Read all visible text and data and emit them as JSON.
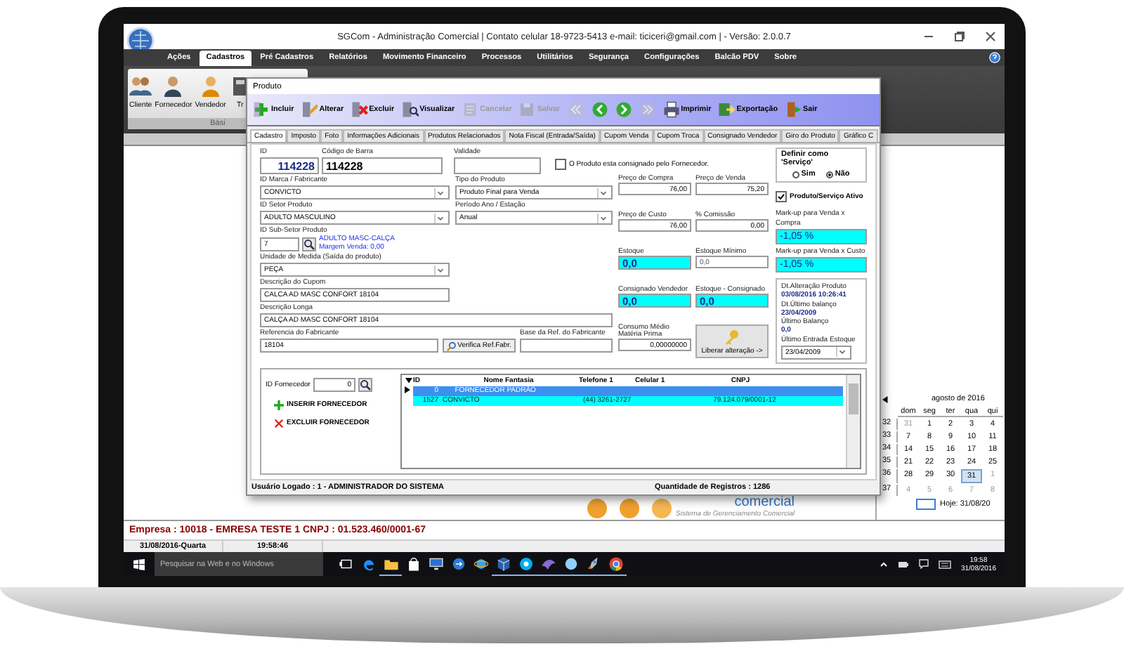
{
  "window": {
    "title": "SGCom - Administração Comercial | Contato celular 18-9723-5413 e-mail: ticiceri@gmail.com | - Versão: 2.0.0.7"
  },
  "menu": [
    {
      "label": "Ações",
      "selected": false
    },
    {
      "label": "Cadastros",
      "selected": true
    },
    {
      "label": "Pré Cadastros",
      "selected": false
    },
    {
      "label": "Relatórios",
      "selected": false
    },
    {
      "label": "Movimento Financeiro",
      "selected": false
    },
    {
      "label": "Processos",
      "selected": false
    },
    {
      "label": "Utilitários",
      "selected": false
    },
    {
      "label": "Segurança",
      "selected": false
    },
    {
      "label": "Configurações",
      "selected": false
    },
    {
      "label": "Balcão PDV",
      "selected": false
    },
    {
      "label": "Sobre",
      "selected": false
    }
  ],
  "ribbon": {
    "items": [
      {
        "label": "Cliente",
        "kind": "people"
      },
      {
        "label": "Fornecedor",
        "kind": "person"
      },
      {
        "label": "Vendedor",
        "kind": "seller"
      },
      {
        "label": "Tr",
        "kind": "box"
      }
    ],
    "group": "Bási"
  },
  "dialog": {
    "title": "Produto",
    "toolbar": [
      {
        "kind": "add",
        "label": "Incluir",
        "disabled": false
      },
      {
        "kind": "edit",
        "label": "Alterar",
        "disabled": false
      },
      {
        "kind": "delete",
        "label": "Excluir",
        "disabled": false
      },
      {
        "kind": "view",
        "label": "Visualizar",
        "disabled": false
      },
      {
        "kind": "cancel",
        "label": "Cancelar",
        "disabled": true
      },
      {
        "kind": "save",
        "label": "Salvar",
        "disabled": true
      },
      {
        "kind": "first",
        "disabled": true
      },
      {
        "kind": "prev",
        "disabled": false
      },
      {
        "kind": "next",
        "disabled": false
      },
      {
        "kind": "last",
        "disabled": true
      },
      {
        "kind": "print",
        "label": "Imprimir",
        "disabled": false
      },
      {
        "kind": "export",
        "label": "Exportação",
        "disabled": false
      },
      {
        "kind": "exit",
        "label": "Sair",
        "disabled": false
      }
    ],
    "tabs": [
      {
        "label": "Cadastro",
        "selected": true
      },
      {
        "label": "Imposto",
        "selected": false
      },
      {
        "label": "Foto",
        "selected": false
      },
      {
        "label": "Informações Adicionais",
        "selected": false
      },
      {
        "label": "Produtos Relacionados",
        "selected": false
      },
      {
        "label": "Nota Fiscal (Entrada/Saída)",
        "selected": false
      },
      {
        "label": "Cupom Venda",
        "selected": false
      },
      {
        "label": "Cupom Troca",
        "selected": false
      },
      {
        "label": "Consignado Vendedor",
        "selected": false
      },
      {
        "label": "Giro do Produto",
        "selected": false
      },
      {
        "label": "Gráfico C",
        "selected": false
      }
    ],
    "id": {
      "label": "ID",
      "value": "114228"
    },
    "barcode": {
      "label": "Código de Barra",
      "value": "114228"
    },
    "validity": {
      "label": "Validade"
    },
    "consigned": {
      "label": "O Produto esta consignado pelo Fornecedor.",
      "checked": false
    },
    "brand": {
      "label": "ID Marca / Fabricante",
      "value": "CONVICTO"
    },
    "product_type": {
      "label": "Tipo do Produto",
      "value": "Produto Final para Venda"
    },
    "sector": {
      "label": "ID Setor Produto",
      "value": "ADULTO MASCULINO"
    },
    "period": {
      "label": "Período Ano / Estação",
      "value": "Anual"
    },
    "subsector": {
      "label": "ID Sub-Setor Produto",
      "value": "7",
      "name": "ADULTO MASC-CALÇA",
      "margin": "Margem Venda: 0,00"
    },
    "unit": {
      "label": "Unidade de Medida (Saída do produto)",
      "value": "PEÇA"
    },
    "coupon_description": {
      "label": "Descrição do Cupom",
      "value": "CALCA AD MASC CONFORT 18104"
    },
    "long_description": {
      "label": "Descrição Longa",
      "value": "CALÇA AD MASC CONFORT 18104"
    },
    "manufacturer_ref": {
      "label": "Referencia do Fabricante",
      "value": "18104"
    },
    "verify_button": "Verifica Ref.Fabr.",
    "ref_base": {
      "label": "Base da Ref. do Fabricante"
    },
    "prices": [
      {
        "label": "Preço de Compra",
        "value": "76,00",
        "kind": "number",
        "highlighted": false
      },
      {
        "label": "Preço de Venda",
        "value": "75,20",
        "kind": "number",
        "highlighted": false
      },
      {
        "label": "Preço de Custo",
        "value": "76,00",
        "kind": "number",
        "highlighted": false
      },
      {
        "label": "% Comissão",
        "value": "0,00",
        "kind": "number",
        "highlighted": false
      },
      {
        "label": "Estoque",
        "value": "0,0",
        "kind": "big",
        "highlighted": true
      },
      {
        "label": "Estoque Mínimo",
        "value": "0,0",
        "kind": "muted",
        "highlighted": false
      },
      {
        "label": "Consignado Vendedor",
        "value": "0,0",
        "kind": "big",
        "highlighted": true
      },
      {
        "label": "Estoque - Consignado",
        "value": "0,0",
        "kind": "big",
        "highlighted": true
      },
      {
        "label": "Consumo Médio Matéria Prima",
        "value": "0,00000000",
        "kind": "number",
        "highlighted": false
      }
    ],
    "unlock_button": "Liberar alteração ->",
    "service": {
      "title": "Definir como 'Serviço'",
      "options": [
        {
          "label": "Sim",
          "selected": false
        },
        {
          "label": "Não",
          "selected": true
        }
      ]
    },
    "active": {
      "label": "Produto/Serviço Ativo",
      "checked": true
    },
    "markups": [
      {
        "label": "Mark-up para Venda x Compra",
        "value": "-1,05 %"
      },
      {
        "label": "Mark-up para Venda x Custo",
        "value": "-1,05 %"
      }
    ],
    "info": [
      {
        "label": "Dt.Alteração Produto",
        "value": "03/08/2016 10:26:41"
      },
      {
        "label": "Dt.Último balanço",
        "value": "23/04/2009"
      },
      {
        "label": "Último Balanço",
        "value": "0,0"
      }
    ],
    "last_entry": {
      "label": "Último Entrada Estoque",
      "value": "23/04/2009"
    },
    "supplier": {
      "label": "ID Fornecedor",
      "value": "0",
      "insert": "INSERIR FORNECEDOR",
      "delete": "EXCLUIR FORNECEDOR"
    },
    "table": {
      "columns": [
        "ID",
        "Nome Fantasia",
        "Telefone 1",
        "Celular 1",
        "CNPJ"
      ],
      "rows": [
        {
          "id": "0",
          "name": "FORNECEDOR PADRÃO",
          "selected": true
        },
        {
          "id": "1527",
          "name": "CONVICTO",
          "phone": "(44) 3261-2727",
          "cnpj": "79.124.079/0001-12",
          "selected": false
        }
      ]
    },
    "status": {
      "user": "Usuário Logado : 1 - ADMINISTRADOR DO SISTEMA",
      "records": "Quantidade de Registros : 1286"
    }
  },
  "logo": {
    "word": "comercial",
    "tagline": "Sistema de Gerenciamento Comercial"
  },
  "calendar": {
    "title": "agosto de 2016",
    "weekdays": [
      "dom",
      "seg",
      "ter",
      "qua",
      "qui"
    ],
    "weeks": [
      {
        "number": "32",
        "days": [
          {
            "label": "31",
            "muted": true,
            "selected": false
          },
          {
            "label": "1",
            "muted": false,
            "selected": false
          },
          {
            "label": "2",
            "muted": false,
            "selected": false
          },
          {
            "label": "3",
            "muted": false,
            "selected": false
          },
          {
            "label": "4",
            "muted": false,
            "selected": false
          }
        ]
      },
      {
        "number": "33",
        "days": [
          {
            "label": "7",
            "muted": false,
            "selected": false
          },
          {
            "label": "8",
            "muted": false,
            "selected": false
          },
          {
            "label": "9",
            "muted": false,
            "selected": false
          },
          {
            "label": "10",
            "muted": false,
            "selected": false
          },
          {
            "label": "11",
            "muted": false,
            "selected": false
          }
        ]
      },
      {
        "number": "34",
        "days": [
          {
            "label": "14",
            "muted": false,
            "selected": false
          },
          {
            "label": "15",
            "muted": false,
            "selected": false
          },
          {
            "label": "16",
            "muted": false,
            "selected": false
          },
          {
            "label": "17",
            "muted": false,
            "selected": false
          },
          {
            "label": "18",
            "muted": false,
            "selected": false
          }
        ]
      },
      {
        "number": "35",
        "days": [
          {
            "label": "21",
            "muted": false,
            "selected": false
          },
          {
            "label": "22",
            "muted": false,
            "selected": false
          },
          {
            "label": "23",
            "muted": false,
            "selected": false
          },
          {
            "label": "24",
            "muted": false,
            "selected": false
          },
          {
            "label": "25",
            "muted": false,
            "selected": false
          }
        ]
      },
      {
        "number": "36",
        "days": [
          {
            "label": "28",
            "muted": false,
            "selected": false
          },
          {
            "label": "29",
            "muted": false,
            "selected": false
          },
          {
            "label": "30",
            "muted": false,
            "selected": false
          },
          {
            "label": "31",
            "muted": false,
            "selected": true
          },
          {
            "label": "1",
            "muted": true,
            "selected": false
          }
        ]
      },
      {
        "number": "37",
        "days": [
          {
            "label": "4",
            "muted": true,
            "selected": false
          },
          {
            "label": "5",
            "muted": true,
            "selected": false
          },
          {
            "label": "6",
            "muted": true,
            "selected": false
          },
          {
            "label": "7",
            "muted": true,
            "selected": false
          },
          {
            "label": "8",
            "muted": true,
            "selected": false
          }
        ]
      }
    ],
    "today": "Hoje: 31/08/20"
  },
  "status_bar": {
    "company": "Empresa : 10018 - EMRESA TESTE 1  CNPJ : 01.523.460/0001-67",
    "date": "31/08/2016-Quarta",
    "time": "19:58:46"
  },
  "taskbar": {
    "search": {
      "placeholder": "Pesquisar na Web e no Windows"
    },
    "apps": [
      {
        "kind": "taskview",
        "running": false
      },
      {
        "kind": "edge",
        "running": false
      },
      {
        "kind": "folder",
        "running": true
      },
      {
        "kind": "bag",
        "running": false
      },
      {
        "kind": "monitor",
        "running": false
      },
      {
        "kind": "bluecircle",
        "running": false
      },
      {
        "kind": "ie",
        "running": false
      },
      {
        "kind": "cube",
        "running": true
      },
      {
        "kind": "skype",
        "running": true
      },
      {
        "kind": "fish",
        "running": true
      },
      {
        "kind": "bubble",
        "running": true
      },
      {
        "kind": "rocket",
        "running": true
      },
      {
        "kind": "chrome",
        "running": true
      }
    ],
    "time": "19:58",
    "date": "31/08/2016"
  }
}
